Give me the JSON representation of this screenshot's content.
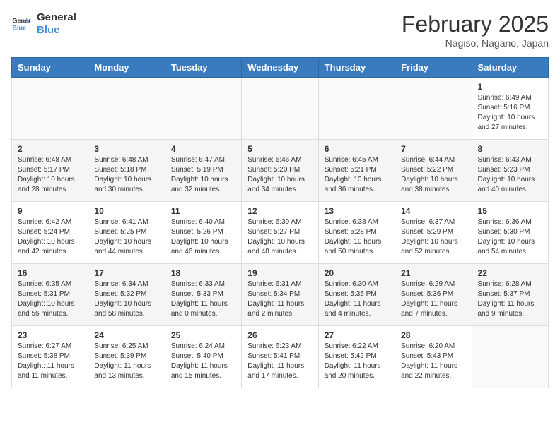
{
  "logo": {
    "line1": "General",
    "line2": "Blue"
  },
  "title": {
    "month_year": "February 2025",
    "location": "Nagiso, Nagano, Japan"
  },
  "days_of_week": [
    "Sunday",
    "Monday",
    "Tuesday",
    "Wednesday",
    "Thursday",
    "Friday",
    "Saturday"
  ],
  "weeks": [
    [
      {
        "day": "",
        "info": ""
      },
      {
        "day": "",
        "info": ""
      },
      {
        "day": "",
        "info": ""
      },
      {
        "day": "",
        "info": ""
      },
      {
        "day": "",
        "info": ""
      },
      {
        "day": "",
        "info": ""
      },
      {
        "day": "1",
        "info": "Sunrise: 6:49 AM\nSunset: 5:16 PM\nDaylight: 10 hours\nand 27 minutes."
      }
    ],
    [
      {
        "day": "2",
        "info": "Sunrise: 6:48 AM\nSunset: 5:17 PM\nDaylight: 10 hours\nand 28 minutes."
      },
      {
        "day": "3",
        "info": "Sunrise: 6:48 AM\nSunset: 5:18 PM\nDaylight: 10 hours\nand 30 minutes."
      },
      {
        "day": "4",
        "info": "Sunrise: 6:47 AM\nSunset: 5:19 PM\nDaylight: 10 hours\nand 32 minutes."
      },
      {
        "day": "5",
        "info": "Sunrise: 6:46 AM\nSunset: 5:20 PM\nDaylight: 10 hours\nand 34 minutes."
      },
      {
        "day": "6",
        "info": "Sunrise: 6:45 AM\nSunset: 5:21 PM\nDaylight: 10 hours\nand 36 minutes."
      },
      {
        "day": "7",
        "info": "Sunrise: 6:44 AM\nSunset: 5:22 PM\nDaylight: 10 hours\nand 38 minutes."
      },
      {
        "day": "8",
        "info": "Sunrise: 6:43 AM\nSunset: 5:23 PM\nDaylight: 10 hours\nand 40 minutes."
      }
    ],
    [
      {
        "day": "9",
        "info": "Sunrise: 6:42 AM\nSunset: 5:24 PM\nDaylight: 10 hours\nand 42 minutes."
      },
      {
        "day": "10",
        "info": "Sunrise: 6:41 AM\nSunset: 5:25 PM\nDaylight: 10 hours\nand 44 minutes."
      },
      {
        "day": "11",
        "info": "Sunrise: 6:40 AM\nSunset: 5:26 PM\nDaylight: 10 hours\nand 46 minutes."
      },
      {
        "day": "12",
        "info": "Sunrise: 6:39 AM\nSunset: 5:27 PM\nDaylight: 10 hours\nand 48 minutes."
      },
      {
        "day": "13",
        "info": "Sunrise: 6:38 AM\nSunset: 5:28 PM\nDaylight: 10 hours\nand 50 minutes."
      },
      {
        "day": "14",
        "info": "Sunrise: 6:37 AM\nSunset: 5:29 PM\nDaylight: 10 hours\nand 52 minutes."
      },
      {
        "day": "15",
        "info": "Sunrise: 6:36 AM\nSunset: 5:30 PM\nDaylight: 10 hours\nand 54 minutes."
      }
    ],
    [
      {
        "day": "16",
        "info": "Sunrise: 6:35 AM\nSunset: 5:31 PM\nDaylight: 10 hours\nand 56 minutes."
      },
      {
        "day": "17",
        "info": "Sunrise: 6:34 AM\nSunset: 5:32 PM\nDaylight: 10 hours\nand 58 minutes."
      },
      {
        "day": "18",
        "info": "Sunrise: 6:33 AM\nSunset: 5:33 PM\nDaylight: 11 hours\nand 0 minutes."
      },
      {
        "day": "19",
        "info": "Sunrise: 6:31 AM\nSunset: 5:34 PM\nDaylight: 11 hours\nand 2 minutes."
      },
      {
        "day": "20",
        "info": "Sunrise: 6:30 AM\nSunset: 5:35 PM\nDaylight: 11 hours\nand 4 minutes."
      },
      {
        "day": "21",
        "info": "Sunrise: 6:29 AM\nSunset: 5:36 PM\nDaylight: 11 hours\nand 7 minutes."
      },
      {
        "day": "22",
        "info": "Sunrise: 6:28 AM\nSunset: 5:37 PM\nDaylight: 11 hours\nand 9 minutes."
      }
    ],
    [
      {
        "day": "23",
        "info": "Sunrise: 6:27 AM\nSunset: 5:38 PM\nDaylight: 11 hours\nand 11 minutes."
      },
      {
        "day": "24",
        "info": "Sunrise: 6:25 AM\nSunset: 5:39 PM\nDaylight: 11 hours\nand 13 minutes."
      },
      {
        "day": "25",
        "info": "Sunrise: 6:24 AM\nSunset: 5:40 PM\nDaylight: 11 hours\nand 15 minutes."
      },
      {
        "day": "26",
        "info": "Sunrise: 6:23 AM\nSunset: 5:41 PM\nDaylight: 11 hours\nand 17 minutes."
      },
      {
        "day": "27",
        "info": "Sunrise: 6:22 AM\nSunset: 5:42 PM\nDaylight: 11 hours\nand 20 minutes."
      },
      {
        "day": "28",
        "info": "Sunrise: 6:20 AM\nSunset: 5:43 PM\nDaylight: 11 hours\nand 22 minutes."
      },
      {
        "day": "",
        "info": ""
      }
    ]
  ]
}
